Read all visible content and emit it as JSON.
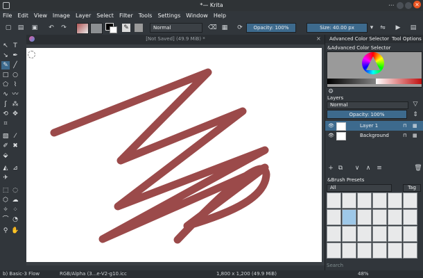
{
  "window": {
    "title": "*— Krita",
    "dots": "...",
    "close_glyph": "×"
  },
  "menu": [
    "File",
    "Edit",
    "View",
    "Image",
    "Layer",
    "Select",
    "Filter",
    "Tools",
    "Settings",
    "Window",
    "Help"
  ],
  "toolbar": {
    "blend_mode": "Normal",
    "opacity_label": "Opacity: 100%",
    "size_label": "Size: 40.00 px"
  },
  "document": {
    "tab_title": "[Not Saved]  (49.9 MiB) *"
  },
  "right_panel": {
    "tab_color": "Advanced Color Selector",
    "tab_tool": "Tool Options",
    "color_section": "&Advanced Color Selector",
    "layers_title": "Layers",
    "layers_blend": "Normal",
    "layers_opacity": "Opacity:  100%",
    "layers": [
      {
        "name": "Layer 1",
        "selected": true
      },
      {
        "name": "Background",
        "selected": false
      }
    ],
    "brush_title": "&Brush Presets",
    "brush_filter": "All",
    "brush_tag": "Tag",
    "search_placeholder": "Search"
  },
  "status": {
    "brush": "b) Basic-3 Flow",
    "color_profile": "RGB/Alpha (3...e-V2-g10.icc",
    "dimensions": "1,800 x 1,200 (49.9 MiB)",
    "zoom": "48%"
  },
  "colors": {
    "stroke": "#9b4a4a",
    "accent": "#3d6a8d",
    "bg": "#31363b"
  }
}
